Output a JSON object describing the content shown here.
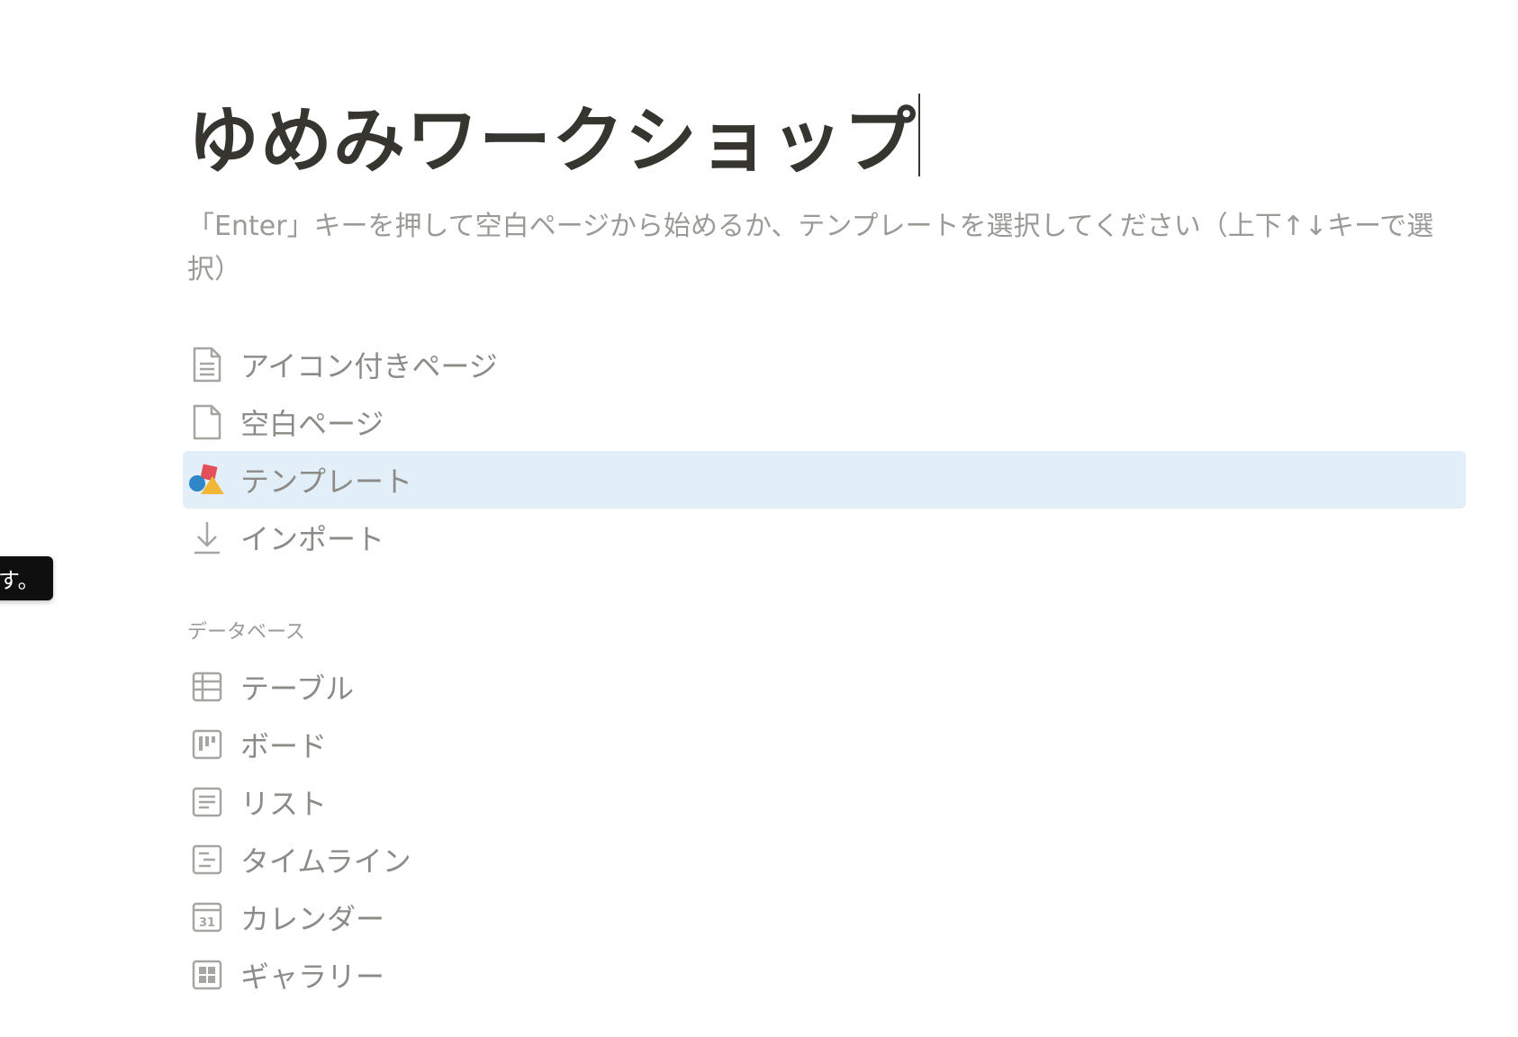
{
  "page": {
    "title": "ゆめみワークショップ",
    "hint": "「Enter」キーを押して空白ページから始めるか、テンプレートを選択してください（上下↑↓キーで選択）"
  },
  "menu": {
    "items": [
      {
        "label": "アイコン付きページ",
        "icon": "page-with-icon-icon",
        "selected": false
      },
      {
        "label": "空白ページ",
        "icon": "blank-page-icon",
        "selected": false
      },
      {
        "label": "テンプレート",
        "icon": "template-shapes-icon",
        "selected": true
      },
      {
        "label": "インポート",
        "icon": "import-arrow-icon",
        "selected": false
      }
    ]
  },
  "database": {
    "header": "データベース",
    "items": [
      {
        "label": "テーブル",
        "icon": "table-icon"
      },
      {
        "label": "ボード",
        "icon": "board-icon"
      },
      {
        "label": "リスト",
        "icon": "list-icon"
      },
      {
        "label": "タイムライン",
        "icon": "timeline-icon"
      },
      {
        "label": "カレンダー",
        "icon": "calendar-icon",
        "icon_text": "31"
      },
      {
        "label": "ギャラリー",
        "icon": "gallery-icon"
      }
    ]
  },
  "tooltip": {
    "text": "す。"
  },
  "colors": {
    "title": "#37352f",
    "muted_text": "#9b9a97",
    "selected_bg": "#e3eff8",
    "icon_gray": "#a6a5a2",
    "tooltip_bg": "#0f0f0f"
  }
}
